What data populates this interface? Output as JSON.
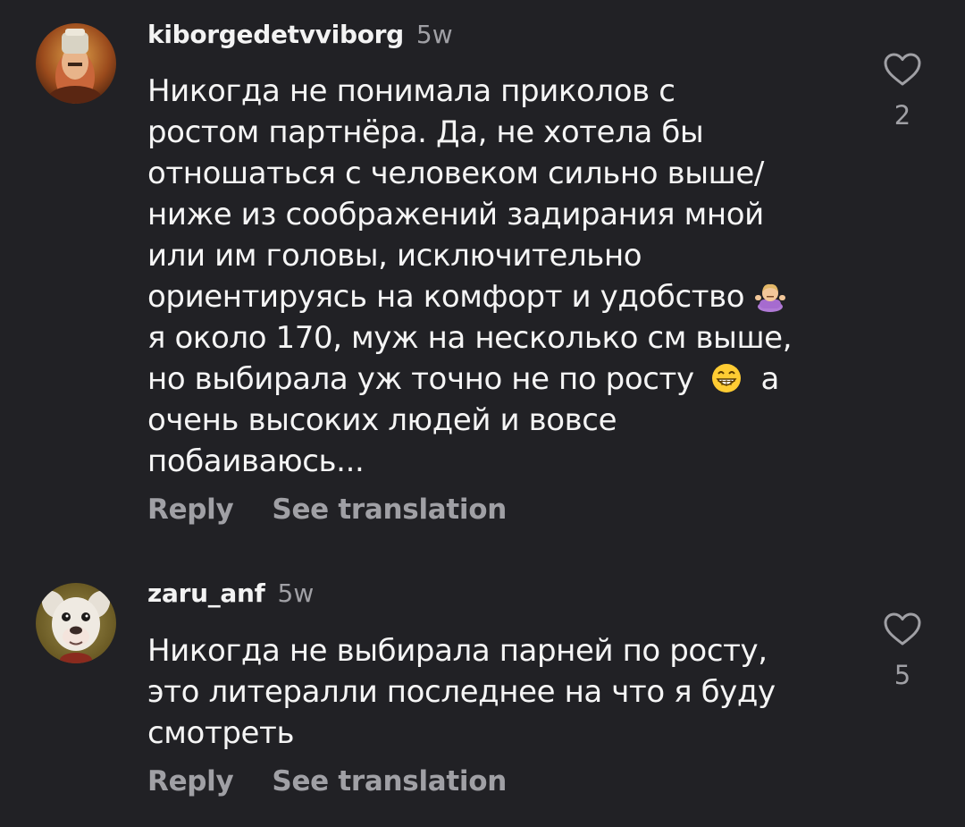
{
  "comments": [
    {
      "username": "kiborgedetvviborg",
      "time": "5w",
      "lines": [
        "Никогда не понимала приколов с",
        "ростом партнёра. Да, не хотела бы",
        "отношаться с человеком сильно выше/",
        "ниже из соображений задирания мной",
        "или им головы, исключительно",
        "ориентируясь на комфорт и удобство",
        "я около 170, муж на несколько см выше,",
        "но выбирала уж точно не по росту",
        "очень высоких людей и вовсе",
        "побаиваюсь..."
      ],
      "line8_tail": "а",
      "emoji_shrug": "person-shrugging-emoji",
      "emoji_grin": "grinning-face-emoji",
      "reply_label": "Reply",
      "translate_label": "See translation",
      "likes": "2",
      "like_icon": "heart-outline-icon"
    },
    {
      "username": "zaru_anf",
      "time": "5w",
      "lines": [
        "Никогда не выбирала парней по росту,",
        "это литералли последнее на что  я буду",
        "смотреть"
      ],
      "reply_label": "Reply",
      "translate_label": "See translation",
      "likes": "5",
      "like_icon": "heart-outline-icon"
    }
  ],
  "colors": {
    "background": "#212125",
    "text": "#f5f5f5",
    "muted": "#a0a0a5"
  }
}
